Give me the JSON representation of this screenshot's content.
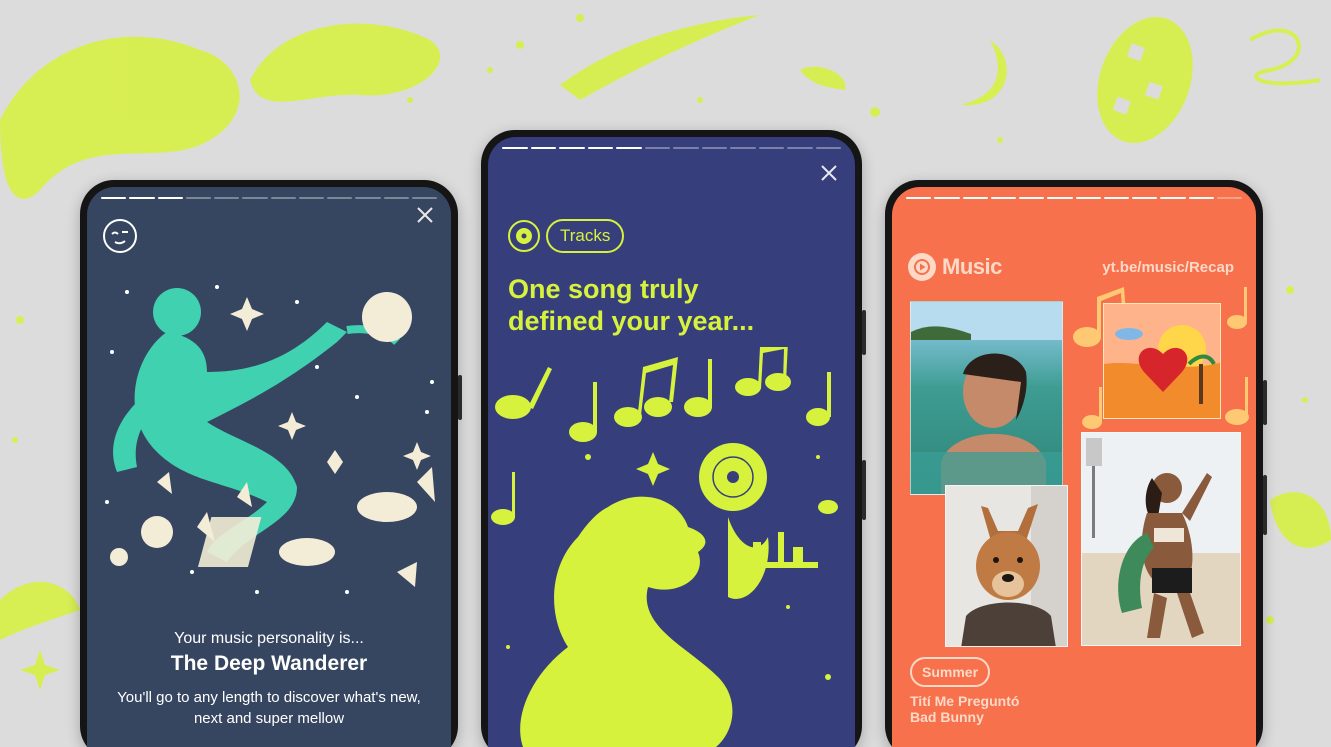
{
  "colors": {
    "background": "#dcdcdc",
    "lime": "#d7f23c",
    "phone1_screen": "#374660",
    "phone2_screen": "#363e7c",
    "phone3_screen": "#f6714c",
    "illustration_teal": "#3fd1b0",
    "cream": "#ffd9c8"
  },
  "phone1": {
    "progress_done": 3,
    "progress_total": 12,
    "intro": "Your music personality is...",
    "personality": "The Deep Wanderer",
    "description": "You'll go to any length to discover what's new, next and super mellow"
  },
  "phone2": {
    "progress_done": 5,
    "progress_total": 12,
    "category": "Tracks",
    "headline_line1": "One song truly",
    "headline_line2": "defined your year..."
  },
  "phone3": {
    "progress_done": 11,
    "progress_total": 12,
    "brand": "Music",
    "link": "yt.be/music/Recap",
    "season": "Summer",
    "song_title": "Tití Me Preguntó",
    "song_artist": "Bad Bunny"
  }
}
